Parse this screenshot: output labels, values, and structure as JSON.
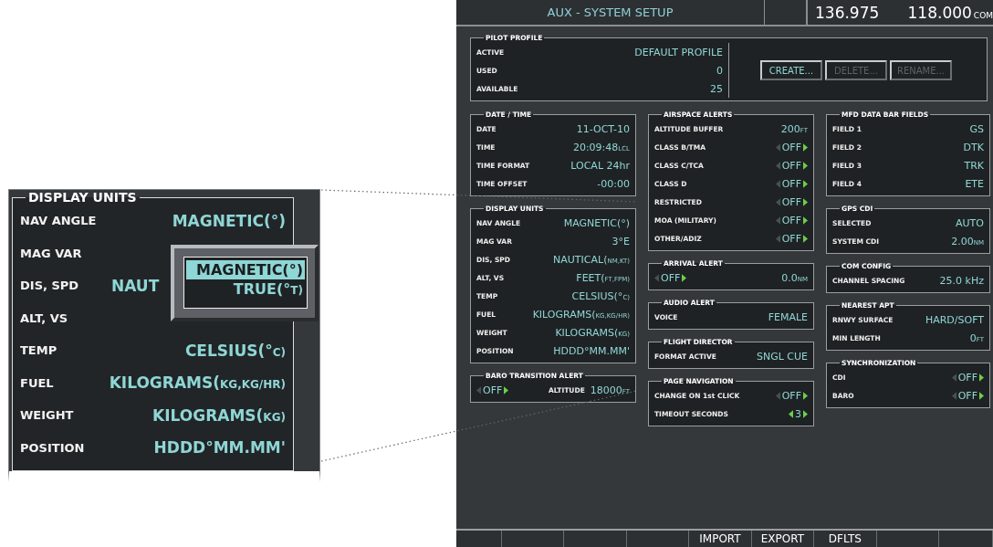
{
  "callout": {
    "title": "DISPLAY UNITS",
    "rows": [
      {
        "label": "NAV ANGLE",
        "value": "MAGNETIC(°)"
      },
      {
        "label": "MAG VAR"
      },
      {
        "label": "DIS, SPD",
        "value": "NAUT",
        "cut_by_popup": true
      },
      {
        "label": "ALT, VS"
      },
      {
        "label": "TEMP",
        "value": "CELSIUS(°",
        "unit": "C)"
      },
      {
        "label": "FUEL",
        "value": "KILOGRAMS(",
        "unit": "KG,KG/HR)"
      },
      {
        "label": "WEIGHT",
        "value": "KILOGRAMS(",
        "unit": "KG)"
      },
      {
        "label": "POSITION",
        "value": "HDDD°MM.MM'"
      }
    ],
    "popup": [
      {
        "value": "MAGNETIC(°)",
        "selected": true
      },
      {
        "value": "TRUE(°",
        "unit": "T)",
        "selected": false
      }
    ]
  },
  "window": {
    "title": "AUX - SYSTEM SETUP",
    "frequencies": [
      {
        "value": "136.975"
      },
      {
        "value": "118.000",
        "unit": "COM"
      }
    ]
  },
  "pilot_profile": {
    "title": "PILOT PROFILE",
    "rows": [
      {
        "label": "ACTIVE",
        "value": "DEFAULT PROFILE"
      },
      {
        "label": "USED",
        "value": "0"
      },
      {
        "label": "AVAILABLE",
        "value": "25"
      }
    ],
    "buttons": [
      {
        "label": "CREATE...",
        "disabled": false
      },
      {
        "label": "DELETE...",
        "disabled": true
      },
      {
        "label": "RENAME...",
        "disabled": true
      }
    ]
  },
  "columns": [
    [
      {
        "title": "DATE / TIME",
        "rows": [
          {
            "kind": "text",
            "label": "DATE",
            "value": "11-OCT-10"
          },
          {
            "kind": "text",
            "label": "TIME",
            "value": "20:09:48",
            "unit": "LCL"
          },
          {
            "kind": "text",
            "label": "TIME FORMAT",
            "value": "LOCAL 24hr"
          },
          {
            "kind": "text",
            "label": "TIME OFFSET",
            "value": "-00:00"
          }
        ]
      },
      {
        "title": "DISPLAY UNITS",
        "rows": [
          {
            "kind": "text",
            "label": "NAV ANGLE",
            "value": "MAGNETIC(°)"
          },
          {
            "kind": "text",
            "label": "MAG VAR",
            "value": "3°E"
          },
          {
            "kind": "text",
            "label": "DIS, SPD",
            "value": "NAUTICAL(",
            "unit": "NM,KT)"
          },
          {
            "kind": "text",
            "label": "ALT, VS",
            "value": "FEET(",
            "unit": "FT,FPM)"
          },
          {
            "kind": "text",
            "label": "TEMP",
            "value": "CELSIUS(°",
            "unit": "C)"
          },
          {
            "kind": "text",
            "label": "FUEL",
            "value": "KILOGRAMS(",
            "unit": "KG,KG/HR)"
          },
          {
            "kind": "text",
            "label": "WEIGHT",
            "value": "KILOGRAMS(",
            "unit": "KG)"
          },
          {
            "kind": "text",
            "label": "POSITION",
            "value": "HDDD°MM.MM'"
          }
        ]
      },
      {
        "title": "BARO TRANSITION ALERT",
        "rows": [
          {
            "kind": "switch-value",
            "switch": {
              "value": "OFF",
              "left_active": false,
              "right_active": true
            },
            "label": "ALTITUDE",
            "value": "18000",
            "unit": "FT"
          }
        ]
      }
    ],
    [
      {
        "title": "AIRSPACE ALERTS",
        "rows": [
          {
            "kind": "text",
            "label": "ALTITUDE BUFFER",
            "value": "200",
            "unit": "FT"
          },
          {
            "kind": "selector",
            "label": "CLASS B/TMA",
            "switch": {
              "value": "OFF",
              "left_active": false,
              "right_active": true
            }
          },
          {
            "kind": "selector",
            "label": "CLASS C/TCA",
            "switch": {
              "value": "OFF",
              "left_active": false,
              "right_active": true
            }
          },
          {
            "kind": "selector",
            "label": "CLASS D",
            "switch": {
              "value": "OFF",
              "left_active": false,
              "right_active": true
            }
          },
          {
            "kind": "selector",
            "label": "RESTRICTED",
            "switch": {
              "value": "OFF",
              "left_active": false,
              "right_active": true
            }
          },
          {
            "kind": "selector",
            "label": "MOA (MILITARY)",
            "switch": {
              "value": "OFF",
              "left_active": false,
              "right_active": true
            }
          },
          {
            "kind": "selector",
            "label": "OTHER/ADIZ",
            "switch": {
              "value": "OFF",
              "left_active": false,
              "right_active": true
            }
          }
        ]
      },
      {
        "title": "ARRIVAL ALERT",
        "rows": [
          {
            "kind": "switch-value",
            "switch": {
              "value": "OFF",
              "left_active": false,
              "right_active": true
            },
            "value": "0.0",
            "unit": "NM"
          }
        ]
      },
      {
        "title": "AUDIO ALERT",
        "rows": [
          {
            "kind": "text",
            "label": "VOICE",
            "value": "FEMALE"
          }
        ]
      },
      {
        "title": "FLIGHT DIRECTOR",
        "rows": [
          {
            "kind": "text",
            "label": "FORMAT ACTIVE",
            "value": "SNGL CUE"
          }
        ]
      },
      {
        "title": "PAGE NAVIGATION",
        "rows": [
          {
            "kind": "selector",
            "label": "CHANGE ON 1st CLICK",
            "switch": {
              "value": "OFF",
              "left_active": false,
              "right_active": true
            }
          },
          {
            "kind": "selector",
            "label": "TIMEOUT SECONDS",
            "switch": {
              "value": "3",
              "left_active": true,
              "right_active": true
            }
          }
        ]
      }
    ],
    [
      {
        "title": "MFD DATA BAR FIELDS",
        "rows": [
          {
            "kind": "text",
            "label": "FIELD 1",
            "value": "GS"
          },
          {
            "kind": "text",
            "label": "FIELD 2",
            "value": "DTK"
          },
          {
            "kind": "text",
            "label": "FIELD 3",
            "value": "TRK"
          },
          {
            "kind": "text",
            "label": "FIELD 4",
            "value": "ETE"
          }
        ]
      },
      {
        "title": "GPS CDI",
        "rows": [
          {
            "kind": "text",
            "label": "SELECTED",
            "value": "AUTO"
          },
          {
            "kind": "text",
            "label": "SYSTEM CDI",
            "value": "2.00",
            "unit": "NM"
          }
        ]
      },
      {
        "title": "COM CONFIG",
        "rows": [
          {
            "kind": "text",
            "label": "CHANNEL SPACING",
            "value": "25.0 kHz"
          }
        ]
      },
      {
        "title": "NEAREST APT",
        "rows": [
          {
            "kind": "text",
            "label": "RNWY SURFACE",
            "value": "HARD/SOFT"
          },
          {
            "kind": "text",
            "label": "MIN LENGTH",
            "value": "0",
            "unit": "FT"
          }
        ]
      },
      {
        "title": "SYNCHRONIZATION",
        "rows": [
          {
            "kind": "selector",
            "label": "CDI",
            "switch": {
              "value": "OFF",
              "left_active": false,
              "right_active": true
            }
          },
          {
            "kind": "selector",
            "label": "BARO",
            "switch": {
              "value": "OFF",
              "left_active": false,
              "right_active": true
            }
          }
        ]
      }
    ]
  ],
  "softkeys": [
    {
      "label": "IMPORT"
    },
    {
      "label": "EXPORT"
    },
    {
      "label": "DFLTS"
    }
  ]
}
